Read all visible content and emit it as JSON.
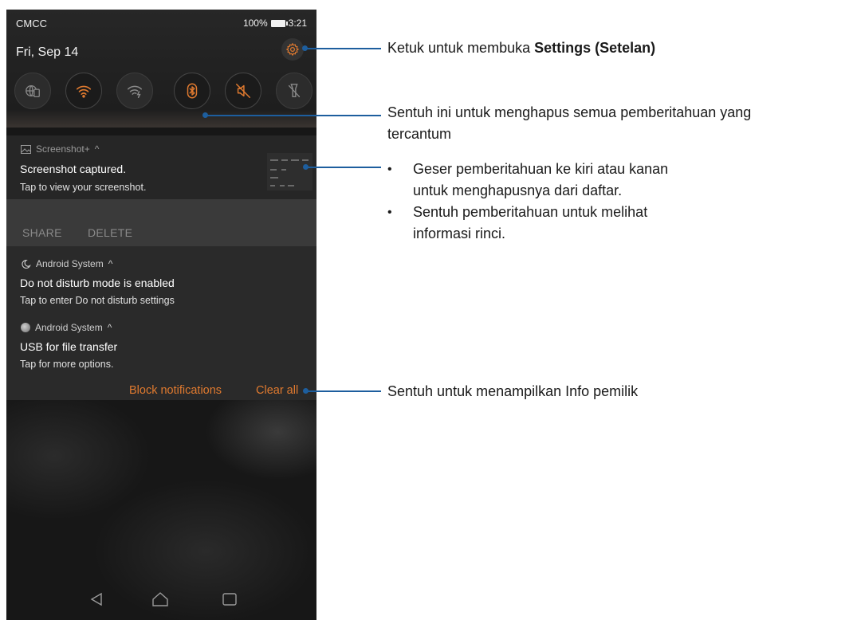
{
  "status_bar": {
    "carrier": "CMCC",
    "battery": "100%",
    "time": "3:21"
  },
  "quick_settings": {
    "date": "Fri, Sep 14",
    "tiles": [
      {
        "icon": "network-globe-icon",
        "active": false
      },
      {
        "icon": "wifi-icon",
        "active": true
      },
      {
        "icon": "wifi-hotspot-icon",
        "active": false
      },
      {
        "icon": "bluetooth-icon",
        "active": true
      },
      {
        "icon": "mute-icon",
        "active": true
      },
      {
        "icon": "flashlight-off-icon",
        "active": false
      }
    ]
  },
  "notifications": [
    {
      "app": "Screenshot+",
      "title": "Screenshot captured.",
      "text": "Tap to view your screenshot.",
      "actions": [
        "SHARE",
        "DELETE"
      ]
    },
    {
      "app": "Android System",
      "title": "Do not disturb mode is enabled",
      "text": "Tap to enter Do not disturb settings"
    },
    {
      "app": "Android System",
      "title": "USB for file transfer",
      "text": "Tap for more options."
    }
  ],
  "footer_actions": {
    "block": "Block notifications",
    "clear": "Clear all"
  },
  "callouts": {
    "settings_prefix": "Ketuk untuk membuka ",
    "settings_bold": "Settings (Setelan)",
    "clear_line1": "Sentuh ini untuk menghapus semua pemberitahuan yang",
    "clear_line2": "tercantum",
    "bullet1_line1": "Geser pemberitahuan ke kiri atau kanan",
    "bullet1_line2": "untuk menghapusnya dari daftar.",
    "bullet2_line1": "Sentuh pemberitahuan untuk melihat",
    "bullet2_line2": "informasi rinci.",
    "owner_info": "Sentuh untuk menampilkan Info pemilik"
  },
  "colors": {
    "accent": "#e07a2f",
    "callout_line": "#1d5e9e"
  }
}
